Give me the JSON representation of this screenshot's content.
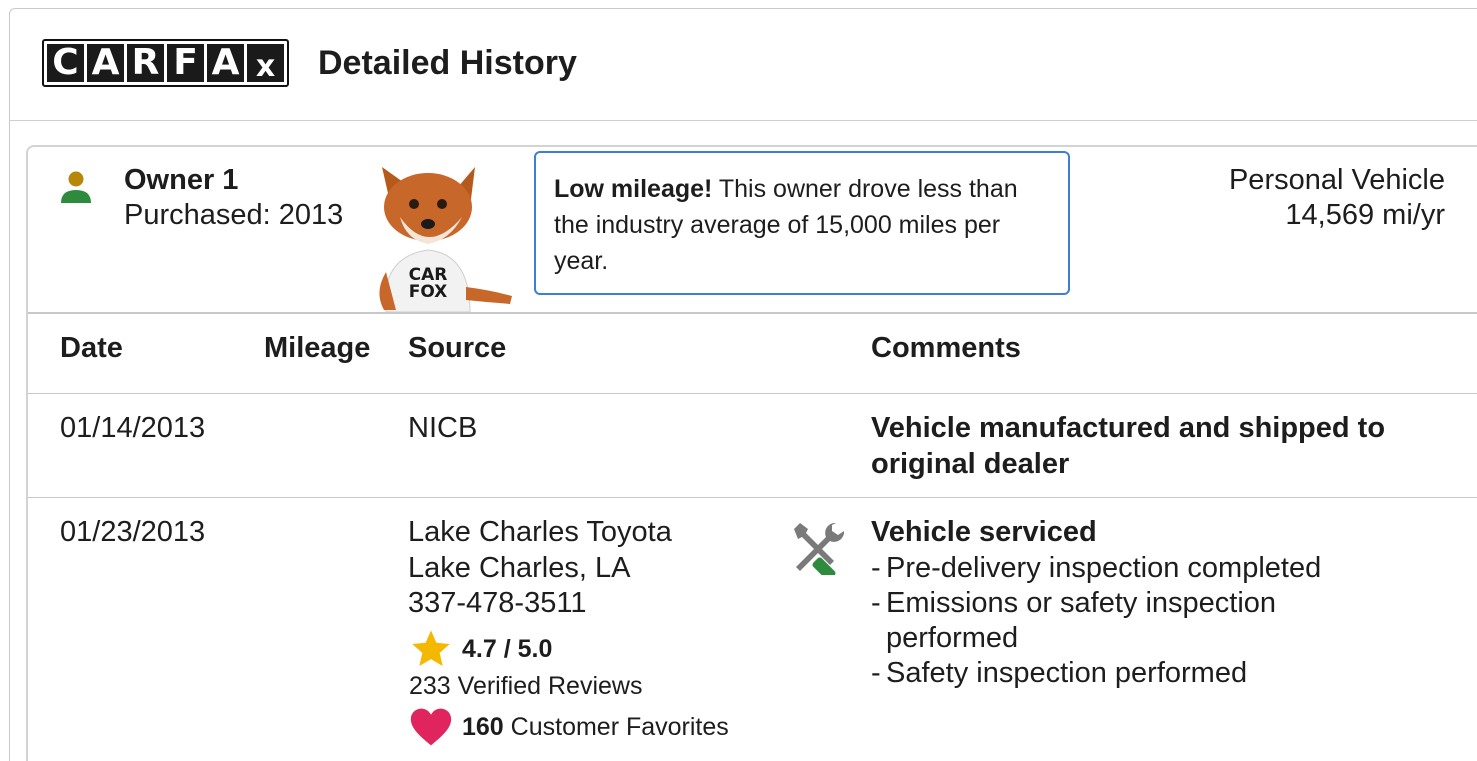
{
  "header": {
    "logo_letters": [
      "C",
      "A",
      "R",
      "F",
      "A",
      "x"
    ],
    "title": "Detailed History"
  },
  "owner": {
    "title": "Owner 1",
    "purchased": "Purchased: 2013",
    "callout_bold": "Low mileage!",
    "callout_text": " This owner drove less than the industry average of 15,000 miles per year.",
    "vehicle_type": "Personal Vehicle",
    "mileage_per_year": "14,569 mi/yr",
    "fox_shirt_line1": "CAR",
    "fox_shirt_line2": "FOX"
  },
  "table": {
    "headers": {
      "date": "Date",
      "mileage": "Mileage",
      "source": "Source",
      "comments": "Comments"
    },
    "rows": [
      {
        "date": "01/14/2013",
        "source": "NICB",
        "comment_title": "Vehicle manufactured and shipped to original dealer"
      },
      {
        "date": "01/23/2013",
        "source_name": "Lake Charles Toyota",
        "source_location": "Lake Charles, LA",
        "source_phone": "337-478-3511",
        "rating": "4.7 / 5.0",
        "reviews": "233 Verified Reviews",
        "favorites_count": "160",
        "favorites_label": " Customer Favorites",
        "comment_title": "Vehicle serviced",
        "comment_items": [
          "Pre-delivery inspection completed",
          "Emissions or safety inspection performed",
          "Safety inspection performed"
        ]
      }
    ]
  },
  "colors": {
    "callout_border": "#3d7fd4",
    "person_head": "#b8860b",
    "person_body": "#2e8b3e",
    "star": "#f5b800",
    "heart": "#e0245e",
    "tool_gray": "#7a7a7a",
    "tool_green": "#2e8b3e"
  }
}
